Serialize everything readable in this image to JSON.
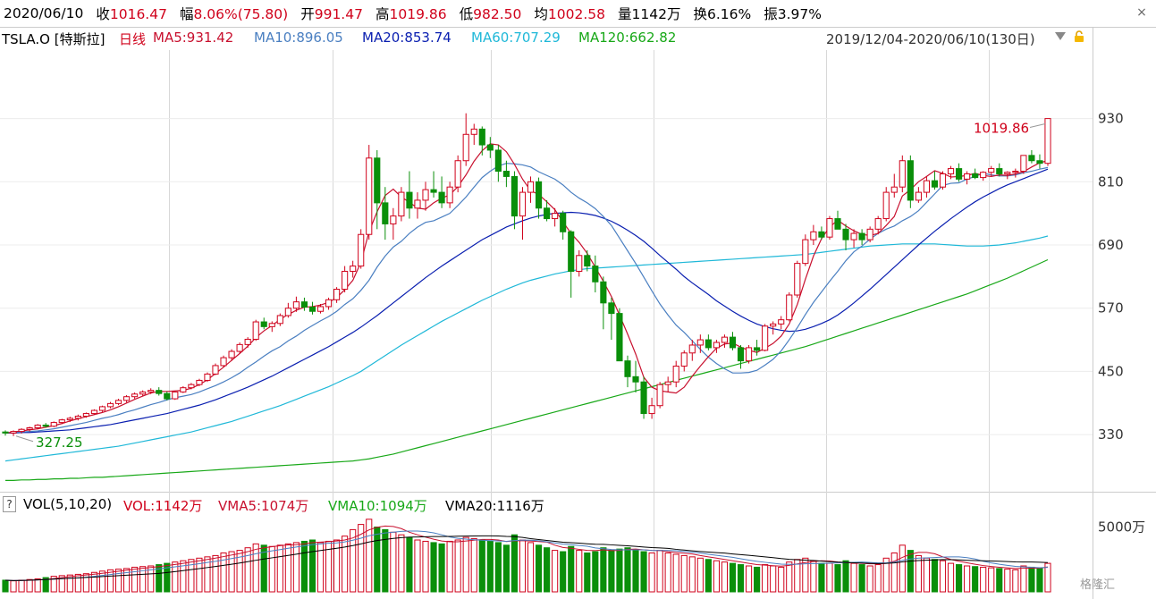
{
  "quote": {
    "date": "2020/06/10",
    "close_label": "收",
    "close": "1016.47",
    "change_label": "幅",
    "change": "8.06%(75.80)",
    "open_label": "开",
    "open": "991.47",
    "high_label": "高",
    "high": "1019.86",
    "low_label": "低",
    "low": "982.50",
    "avg_label": "均",
    "avg": "1002.58",
    "volume_label": "量",
    "volume": "1142万",
    "turnover_label": "换",
    "turnover": "6.16%",
    "amplitude_label": "振",
    "amplitude": "3.97%"
  },
  "legend": {
    "symbol": "TSLA.O [特斯拉]",
    "period": "日线",
    "ma5": "MA5:931.42",
    "ma10": "MA10:896.05",
    "ma20": "MA20:853.74",
    "ma60": "MA60:707.29",
    "ma120": "MA120:662.82",
    "range": "2019/12/04-2020/06/10(130日)"
  },
  "volume_legend": {
    "question": "?",
    "vol": "VOL(5,10,20)",
    "vol_now": "VOL:1142万",
    "vma5": "VMA5:1074万",
    "vma10": "VMA10:1094万",
    "vma20": "VMA20:1116万"
  },
  "close_icon": "×",
  "watermark": "格隆汇",
  "colors": {
    "up": "#d0021b",
    "down": "#0a8f0a",
    "ma5": "#c8102e",
    "ma10": "#4a7fc1",
    "ma20": "#0a1fb0",
    "ma60": "#1fb8d8",
    "ma120": "#18a818",
    "grid": "#d8d8d8"
  },
  "chart_data": {
    "type": "candlestick",
    "price_axis": {
      "ticks": [
        330,
        450,
        570,
        690,
        810,
        930
      ],
      "range": [
        225,
        1060
      ]
    },
    "volume_axis": {
      "ticks": [
        "5000万"
      ],
      "tick_values": [
        5000
      ]
    },
    "annotations": {
      "max_label": "1019.86",
      "min_label": "327.25"
    },
    "candles": [
      [
        335,
        338,
        328,
        333,
        900
      ],
      [
        333,
        338,
        327.25,
        336,
        850
      ],
      [
        336,
        342,
        332,
        340,
        900
      ],
      [
        340,
        345,
        336,
        343,
        950
      ],
      [
        343,
        350,
        340,
        348,
        1000
      ],
      [
        348,
        352,
        343,
        346,
        1100
      ],
      [
        346,
        355,
        344,
        353,
        1200
      ],
      [
        353,
        360,
        350,
        358,
        1250
      ],
      [
        358,
        364,
        354,
        361,
        1300
      ],
      [
        361,
        368,
        357,
        365,
        1350
      ],
      [
        365,
        372,
        362,
        370,
        1400
      ],
      [
        370,
        378,
        368,
        376,
        1500
      ],
      [
        376,
        385,
        373,
        383,
        1600
      ],
      [
        383,
        392,
        380,
        389,
        1700
      ],
      [
        389,
        398,
        386,
        395,
        1750
      ],
      [
        395,
        405,
        391,
        402,
        1800
      ],
      [
        402,
        410,
        398,
        407,
        1900
      ],
      [
        407,
        414,
        403,
        411,
        1950
      ],
      [
        411,
        418,
        407,
        414,
        2000
      ],
      [
        414,
        420,
        404,
        408,
        2100
      ],
      [
        408,
        412,
        395,
        398,
        2200
      ],
      [
        398,
        413,
        396,
        411,
        2300
      ],
      [
        411,
        422,
        409,
        419,
        2400
      ],
      [
        419,
        428,
        416,
        425,
        2500
      ],
      [
        425,
        436,
        422,
        433,
        2600
      ],
      [
        433,
        448,
        430,
        445,
        2700
      ],
      [
        445,
        465,
        443,
        461,
        2800
      ],
      [
        461,
        480,
        458,
        476,
        3000
      ],
      [
        476,
        492,
        470,
        488,
        3100
      ],
      [
        488,
        505,
        485,
        501,
        3200
      ],
      [
        501,
        515,
        495,
        511,
        3400
      ],
      [
        511,
        548,
        508,
        544,
        3700
      ],
      [
        544,
        552,
        530,
        535,
        3600
      ],
      [
        535,
        545,
        525,
        541,
        3500
      ],
      [
        541,
        560,
        536,
        556,
        3600
      ],
      [
        556,
        580,
        552,
        570,
        3700
      ],
      [
        570,
        592,
        563,
        582,
        3800
      ],
      [
        582,
        590,
        565,
        572,
        3900
      ],
      [
        572,
        582,
        558,
        564,
        4000
      ],
      [
        564,
        578,
        560,
        573,
        3800
      ],
      [
        573,
        590,
        567,
        586,
        3900
      ],
      [
        586,
        610,
        580,
        606,
        4000
      ],
      [
        606,
        650,
        600,
        640,
        4300
      ],
      [
        640,
        660,
        628,
        650,
        4800
      ],
      [
        650,
        720,
        645,
        710,
        5200
      ],
      [
        710,
        880,
        700,
        855,
        5600
      ],
      [
        855,
        870,
        720,
        770,
        5000
      ],
      [
        770,
        800,
        700,
        730,
        4800
      ],
      [
        730,
        760,
        700,
        745,
        4600
      ],
      [
        745,
        800,
        735,
        790,
        4400
      ],
      [
        790,
        830,
        740,
        760,
        4200
      ],
      [
        760,
        790,
        740,
        775,
        4000
      ],
      [
        775,
        810,
        755,
        795,
        3900
      ],
      [
        795,
        830,
        780,
        790,
        3800
      ],
      [
        790,
        820,
        760,
        770,
        3700
      ],
      [
        770,
        810,
        760,
        800,
        3900
      ],
      [
        800,
        860,
        790,
        850,
        4000
      ],
      [
        850,
        940,
        840,
        900,
        4200
      ],
      [
        900,
        920,
        880,
        910,
        4100
      ],
      [
        910,
        915,
        860,
        880,
        4000
      ],
      [
        880,
        895,
        855,
        870,
        3900
      ],
      [
        870,
        880,
        810,
        830,
        3800
      ],
      [
        830,
        850,
        800,
        820,
        3600
      ],
      [
        820,
        830,
        720,
        745,
        4400
      ],
      [
        745,
        800,
        700,
        790,
        4000
      ],
      [
        790,
        820,
        770,
        810,
        3800
      ],
      [
        810,
        818,
        740,
        760,
        3600
      ],
      [
        760,
        775,
        735,
        740,
        3400
      ],
      [
        740,
        760,
        725,
        750,
        3200
      ],
      [
        750,
        755,
        700,
        715,
        3100
      ],
      [
        715,
        718,
        590,
        640,
        3500
      ],
      [
        640,
        680,
        630,
        670,
        3200
      ],
      [
        670,
        680,
        640,
        650,
        3000
      ],
      [
        650,
        670,
        600,
        620,
        3100
      ],
      [
        620,
        630,
        530,
        580,
        3400
      ],
      [
        580,
        590,
        510,
        560,
        3200
      ],
      [
        560,
        570,
        470,
        470,
        3300
      ],
      [
        470,
        480,
        420,
        440,
        3400
      ],
      [
        440,
        470,
        410,
        430,
        3200
      ],
      [
        430,
        440,
        360,
        370,
        3100
      ],
      [
        370,
        400,
        360,
        385,
        3000
      ],
      [
        385,
        430,
        380,
        425,
        3200
      ],
      [
        425,
        440,
        410,
        430,
        3000
      ],
      [
        430,
        470,
        420,
        460,
        2900
      ],
      [
        460,
        490,
        450,
        485,
        2800
      ],
      [
        485,
        510,
        470,
        500,
        2700
      ],
      [
        500,
        520,
        485,
        510,
        2600
      ],
      [
        510,
        520,
        490,
        495,
        2500
      ],
      [
        495,
        510,
        485,
        505,
        2400
      ],
      [
        505,
        520,
        495,
        515,
        2300
      ],
      [
        515,
        525,
        490,
        495,
        2200
      ],
      [
        495,
        500,
        455,
        470,
        2100
      ],
      [
        470,
        500,
        465,
        495,
        2000
      ],
      [
        495,
        510,
        480,
        490,
        1900
      ],
      [
        490,
        540,
        488,
        536,
        2100
      ],
      [
        536,
        545,
        520,
        540,
        2000
      ],
      [
        540,
        555,
        530,
        548,
        1900
      ],
      [
        548,
        600,
        545,
        595,
        2300
      ],
      [
        595,
        660,
        590,
        655,
        2500
      ],
      [
        655,
        710,
        650,
        700,
        2600
      ],
      [
        700,
        728,
        690,
        715,
        2400
      ],
      [
        715,
        725,
        700,
        705,
        2200
      ],
      [
        705,
        745,
        700,
        740,
        2200
      ],
      [
        740,
        755,
        720,
        720,
        2100
      ],
      [
        720,
        730,
        680,
        700,
        2400
      ],
      [
        700,
        720,
        685,
        712,
        2200
      ],
      [
        712,
        720,
        690,
        700,
        2100
      ],
      [
        700,
        725,
        695,
        720,
        2000
      ],
      [
        720,
        745,
        710,
        740,
        2100
      ],
      [
        740,
        800,
        735,
        790,
        2600
      ],
      [
        790,
        825,
        780,
        800,
        3000
      ],
      [
        800,
        860,
        790,
        850,
        3600
      ],
      [
        850,
        860,
        760,
        775,
        3200
      ],
      [
        775,
        800,
        770,
        790,
        2800
      ],
      [
        790,
        820,
        780,
        812,
        2600
      ],
      [
        812,
        830,
        795,
        800,
        2500
      ],
      [
        800,
        830,
        795,
        825,
        2400
      ],
      [
        825,
        840,
        815,
        835,
        2200
      ],
      [
        835,
        845,
        810,
        815,
        2100
      ],
      [
        815,
        830,
        805,
        825,
        2000
      ],
      [
        825,
        835,
        815,
        818,
        1950
      ],
      [
        818,
        830,
        812,
        828,
        1900
      ],
      [
        828,
        840,
        820,
        835,
        1850
      ],
      [
        835,
        845,
        820,
        825,
        1800
      ],
      [
        825,
        830,
        815,
        828,
        1750
      ],
      [
        828,
        835,
        818,
        830,
        1700
      ],
      [
        830,
        860,
        825,
        860,
        2000
      ],
      [
        860,
        870,
        845,
        850,
        1900
      ],
      [
        850,
        862,
        835,
        845,
        1800
      ],
      [
        845,
        920,
        840,
        930,
        2200
      ]
    ],
    "ma5": [
      333,
      335,
      337,
      339,
      341,
      344,
      347,
      351,
      356,
      360,
      364,
      368,
      372,
      377,
      383,
      390,
      397,
      403,
      409,
      412,
      412,
      413,
      414,
      418,
      425,
      434,
      446,
      458,
      471,
      484,
      498,
      514,
      527,
      537,
      549,
      558,
      566,
      572,
      573,
      576,
      581,
      590,
      605,
      623,
      657,
      715,
      753,
      784,
      796,
      781,
      771,
      760,
      758,
      770,
      779,
      785,
      801,
      823,
      849,
      869,
      882,
      880,
      867,
      843,
      815,
      793,
      786,
      772,
      757,
      734,
      712,
      695,
      674,
      648,
      621,
      592,
      557,
      521,
      483,
      439,
      420,
      413,
      411,
      409,
      420,
      441,
      460,
      478,
      494,
      502,
      504,
      496,
      490,
      486,
      494,
      503,
      517,
      540,
      577,
      625,
      669,
      702,
      724,
      737,
      726,
      717,
      710,
      708,
      712,
      727,
      744,
      783,
      795,
      810,
      820,
      831,
      826,
      819,
      820,
      822,
      826,
      822,
      820,
      823,
      822,
      825,
      829,
      838,
      846,
      850
    ],
    "ma10": [
      333,
      334,
      335,
      336,
      337,
      339,
      341,
      344,
      347,
      350,
      353,
      357,
      361,
      364,
      368,
      373,
      377,
      382,
      387,
      391,
      396,
      400,
      403,
      406,
      411,
      417,
      423,
      430,
      438,
      447,
      458,
      468,
      479,
      489,
      497,
      508,
      517,
      528,
      537,
      546,
      554,
      564,
      577,
      588,
      604,
      623,
      648,
      669,
      686,
      697,
      712,
      724,
      733,
      736,
      743,
      750,
      765,
      781,
      800,
      818,
      830,
      840,
      845,
      844,
      842,
      838,
      829,
      822,
      815,
      804,
      790,
      779,
      770,
      759,
      744,
      727,
      703,
      679,
      655,
      629,
      603,
      578,
      557,
      538,
      524,
      508,
      492,
      477,
      465,
      455,
      447,
      447,
      448,
      452,
      462,
      473,
      489,
      510,
      533,
      558,
      581,
      601,
      621,
      640,
      660,
      677,
      688,
      701,
      712,
      720,
      726,
      736,
      744,
      755,
      771,
      787,
      803,
      807,
      808,
      815,
      820,
      826,
      823,
      821,
      821,
      823,
      827,
      830,
      834,
      837
    ],
    "ma20": [
      333,
      333,
      334,
      334,
      335,
      336,
      337,
      338,
      339,
      341,
      343,
      345,
      347,
      349,
      352,
      355,
      358,
      361,
      364,
      367,
      370,
      374,
      378,
      382,
      386,
      391,
      396,
      402,
      408,
      414,
      420,
      427,
      434,
      441,
      449,
      457,
      465,
      473,
      481,
      489,
      497,
      506,
      515,
      524,
      534,
      545,
      556,
      568,
      580,
      592,
      604,
      616,
      628,
      639,
      650,
      660,
      670,
      680,
      690,
      700,
      708,
      716,
      724,
      730,
      736,
      741,
      745,
      748,
      750,
      751,
      752,
      751,
      749,
      746,
      741,
      735,
      727,
      718,
      708,
      697,
      684,
      670,
      657,
      644,
      630,
      618,
      607,
      596,
      584,
      574,
      564,
      555,
      547,
      540,
      535,
      531,
      528,
      526,
      527,
      530,
      535,
      541,
      548,
      557,
      568,
      580,
      593,
      606,
      620,
      634,
      648,
      662,
      676,
      690,
      703,
      716,
      728,
      740,
      751,
      762,
      772,
      781,
      789,
      797,
      804,
      810,
      816,
      822,
      828,
      834
    ],
    "ma60": [
      280,
      282,
      284,
      286,
      288,
      290,
      292,
      294,
      296,
      298,
      300,
      302,
      304,
      306,
      308,
      311,
      314,
      317,
      320,
      323,
      326,
      329,
      332,
      335,
      339,
      343,
      347,
      351,
      355,
      360,
      365,
      370,
      375,
      380,
      385,
      391,
      397,
      403,
      409,
      415,
      421,
      428,
      435,
      442,
      450,
      460,
      470,
      480,
      490,
      500,
      509,
      518,
      527,
      536,
      545,
      553,
      561,
      569,
      577,
      585,
      592,
      599,
      606,
      612,
      618,
      623,
      627,
      631,
      635,
      638,
      641,
      643,
      645,
      646,
      647,
      648,
      649,
      650,
      651,
      652,
      653,
      654,
      655,
      656,
      657,
      658,
      659,
      660,
      661,
      662,
      663,
      664,
      665,
      666,
      667,
      668,
      669,
      670,
      671,
      672,
      674,
      676,
      678,
      680,
      682,
      684,
      686,
      688,
      689,
      690,
      691,
      692,
      692,
      692,
      692,
      692,
      691,
      690,
      689,
      688,
      688,
      688,
      689,
      690,
      692,
      694,
      697,
      700,
      703,
      707
    ],
    "ma120": [
      243,
      243,
      244,
      244,
      245,
      245,
      246,
      246,
      247,
      247,
      248,
      249,
      249,
      250,
      251,
      252,
      253,
      254,
      255,
      256,
      257,
      258,
      259,
      260,
      261,
      262,
      263,
      264,
      265,
      266,
      267,
      268,
      269,
      270,
      271,
      272,
      273,
      274,
      275,
      276,
      277,
      278,
      279,
      280,
      282,
      284,
      287,
      290,
      293,
      297,
      301,
      305,
      309,
      313,
      317,
      321,
      325,
      329,
      333,
      337,
      341,
      345,
      349,
      353,
      357,
      361,
      365,
      369,
      373,
      377,
      381,
      385,
      389,
      393,
      397,
      401,
      405,
      409,
      413,
      417,
      421,
      425,
      429,
      433,
      437,
      441,
      445,
      449,
      453,
      457,
      461,
      465,
      469,
      473,
      477,
      481,
      485,
      489,
      493,
      497,
      502,
      507,
      512,
      517,
      522,
      527,
      532,
      537,
      542,
      547,
      552,
      557,
      562,
      567,
      572,
      577,
      582,
      587,
      592,
      597,
      603,
      609,
      615,
      621,
      627,
      634,
      641,
      648,
      655,
      662
    ]
  }
}
